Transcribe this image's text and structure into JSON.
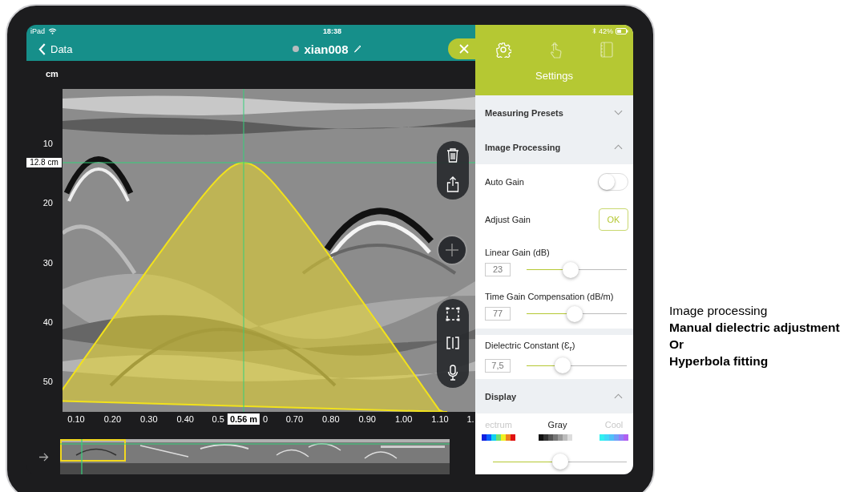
{
  "status_bar": {
    "device": "iPad",
    "time": "18:38",
    "battery": "42%"
  },
  "nav_bar": {
    "back": "Data",
    "file_name": "xian008"
  },
  "radargram": {
    "kind": "picture",
    "y_unit": "cm",
    "depth_marker": "12.8 cm",
    "position_marker": "0.56 m",
    "y_labels": [
      "10",
      "20",
      "30",
      "40",
      "50"
    ],
    "x_labels": [
      {
        "text": "0.10",
        "kind": "whole"
      },
      {
        "text": "0.20",
        "kind": "whole"
      },
      {
        "text": "0.30",
        "kind": "whole"
      },
      {
        "text": "0.40",
        "kind": "whole"
      },
      {
        "text": "0.5",
        "kind": "cut-end"
      },
      {
        "text": "0",
        "kind": "cut-start"
      },
      {
        "text": "0.70",
        "kind": "whole"
      },
      {
        "text": "0.80",
        "kind": "whole"
      },
      {
        "text": "0.90",
        "kind": "whole"
      },
      {
        "text": "1.00",
        "kind": "whole"
      },
      {
        "text": "1.10",
        "kind": "whole"
      },
      {
        "text": "1.",
        "kind": "cut-end"
      }
    ]
  },
  "settings_panel": {
    "title": "Settings",
    "tabs": [
      {
        "selected": true
      },
      {
        "selected": false
      },
      {
        "selected": false
      }
    ],
    "rows": [
      {
        "kind": "section",
        "label": "Measuring Presets",
        "expanded": false
      },
      {
        "kind": "section",
        "label": "Image Processing",
        "expanded": true
      },
      {
        "kind": "toggle",
        "label": "Auto Gain",
        "on": false
      },
      {
        "kind": "button",
        "label": "Adjust Gain",
        "button": "OK"
      },
      {
        "kind": "slider",
        "label": "Linear Gain (dB)",
        "value": "23",
        "level": 0.44
      },
      {
        "kind": "slider",
        "label": "Time Gain Compensation (dB/m)",
        "value": "77",
        "level": 0.48
      },
      {
        "kind": "gap"
      },
      {
        "kind": "slider",
        "label": "Dielectric Constant (Ɛ$_{r}$)",
        "value": "7,5",
        "level": 0.36
      },
      {
        "kind": "section",
        "label": "Display",
        "expanded": true
      }
    ],
    "colormaps": [
      {
        "label": "ectrum",
        "kind": "spectrum",
        "selected": false
      },
      {
        "label": "Gray",
        "kind": "gray",
        "selected": true
      },
      {
        "label": "Cool",
        "kind": "cool",
        "selected": false
      }
    ],
    "display_slider": {
      "level": 0.5
    }
  },
  "caption": [
    {
      "text": "Image processing",
      "bold": false
    },
    {
      "text": "Manual dielectric adjustment",
      "bold": true
    },
    {
      "text": "Or",
      "bold": true
    },
    {
      "text": "Hyperbola fitting",
      "bold": true
    }
  ]
}
